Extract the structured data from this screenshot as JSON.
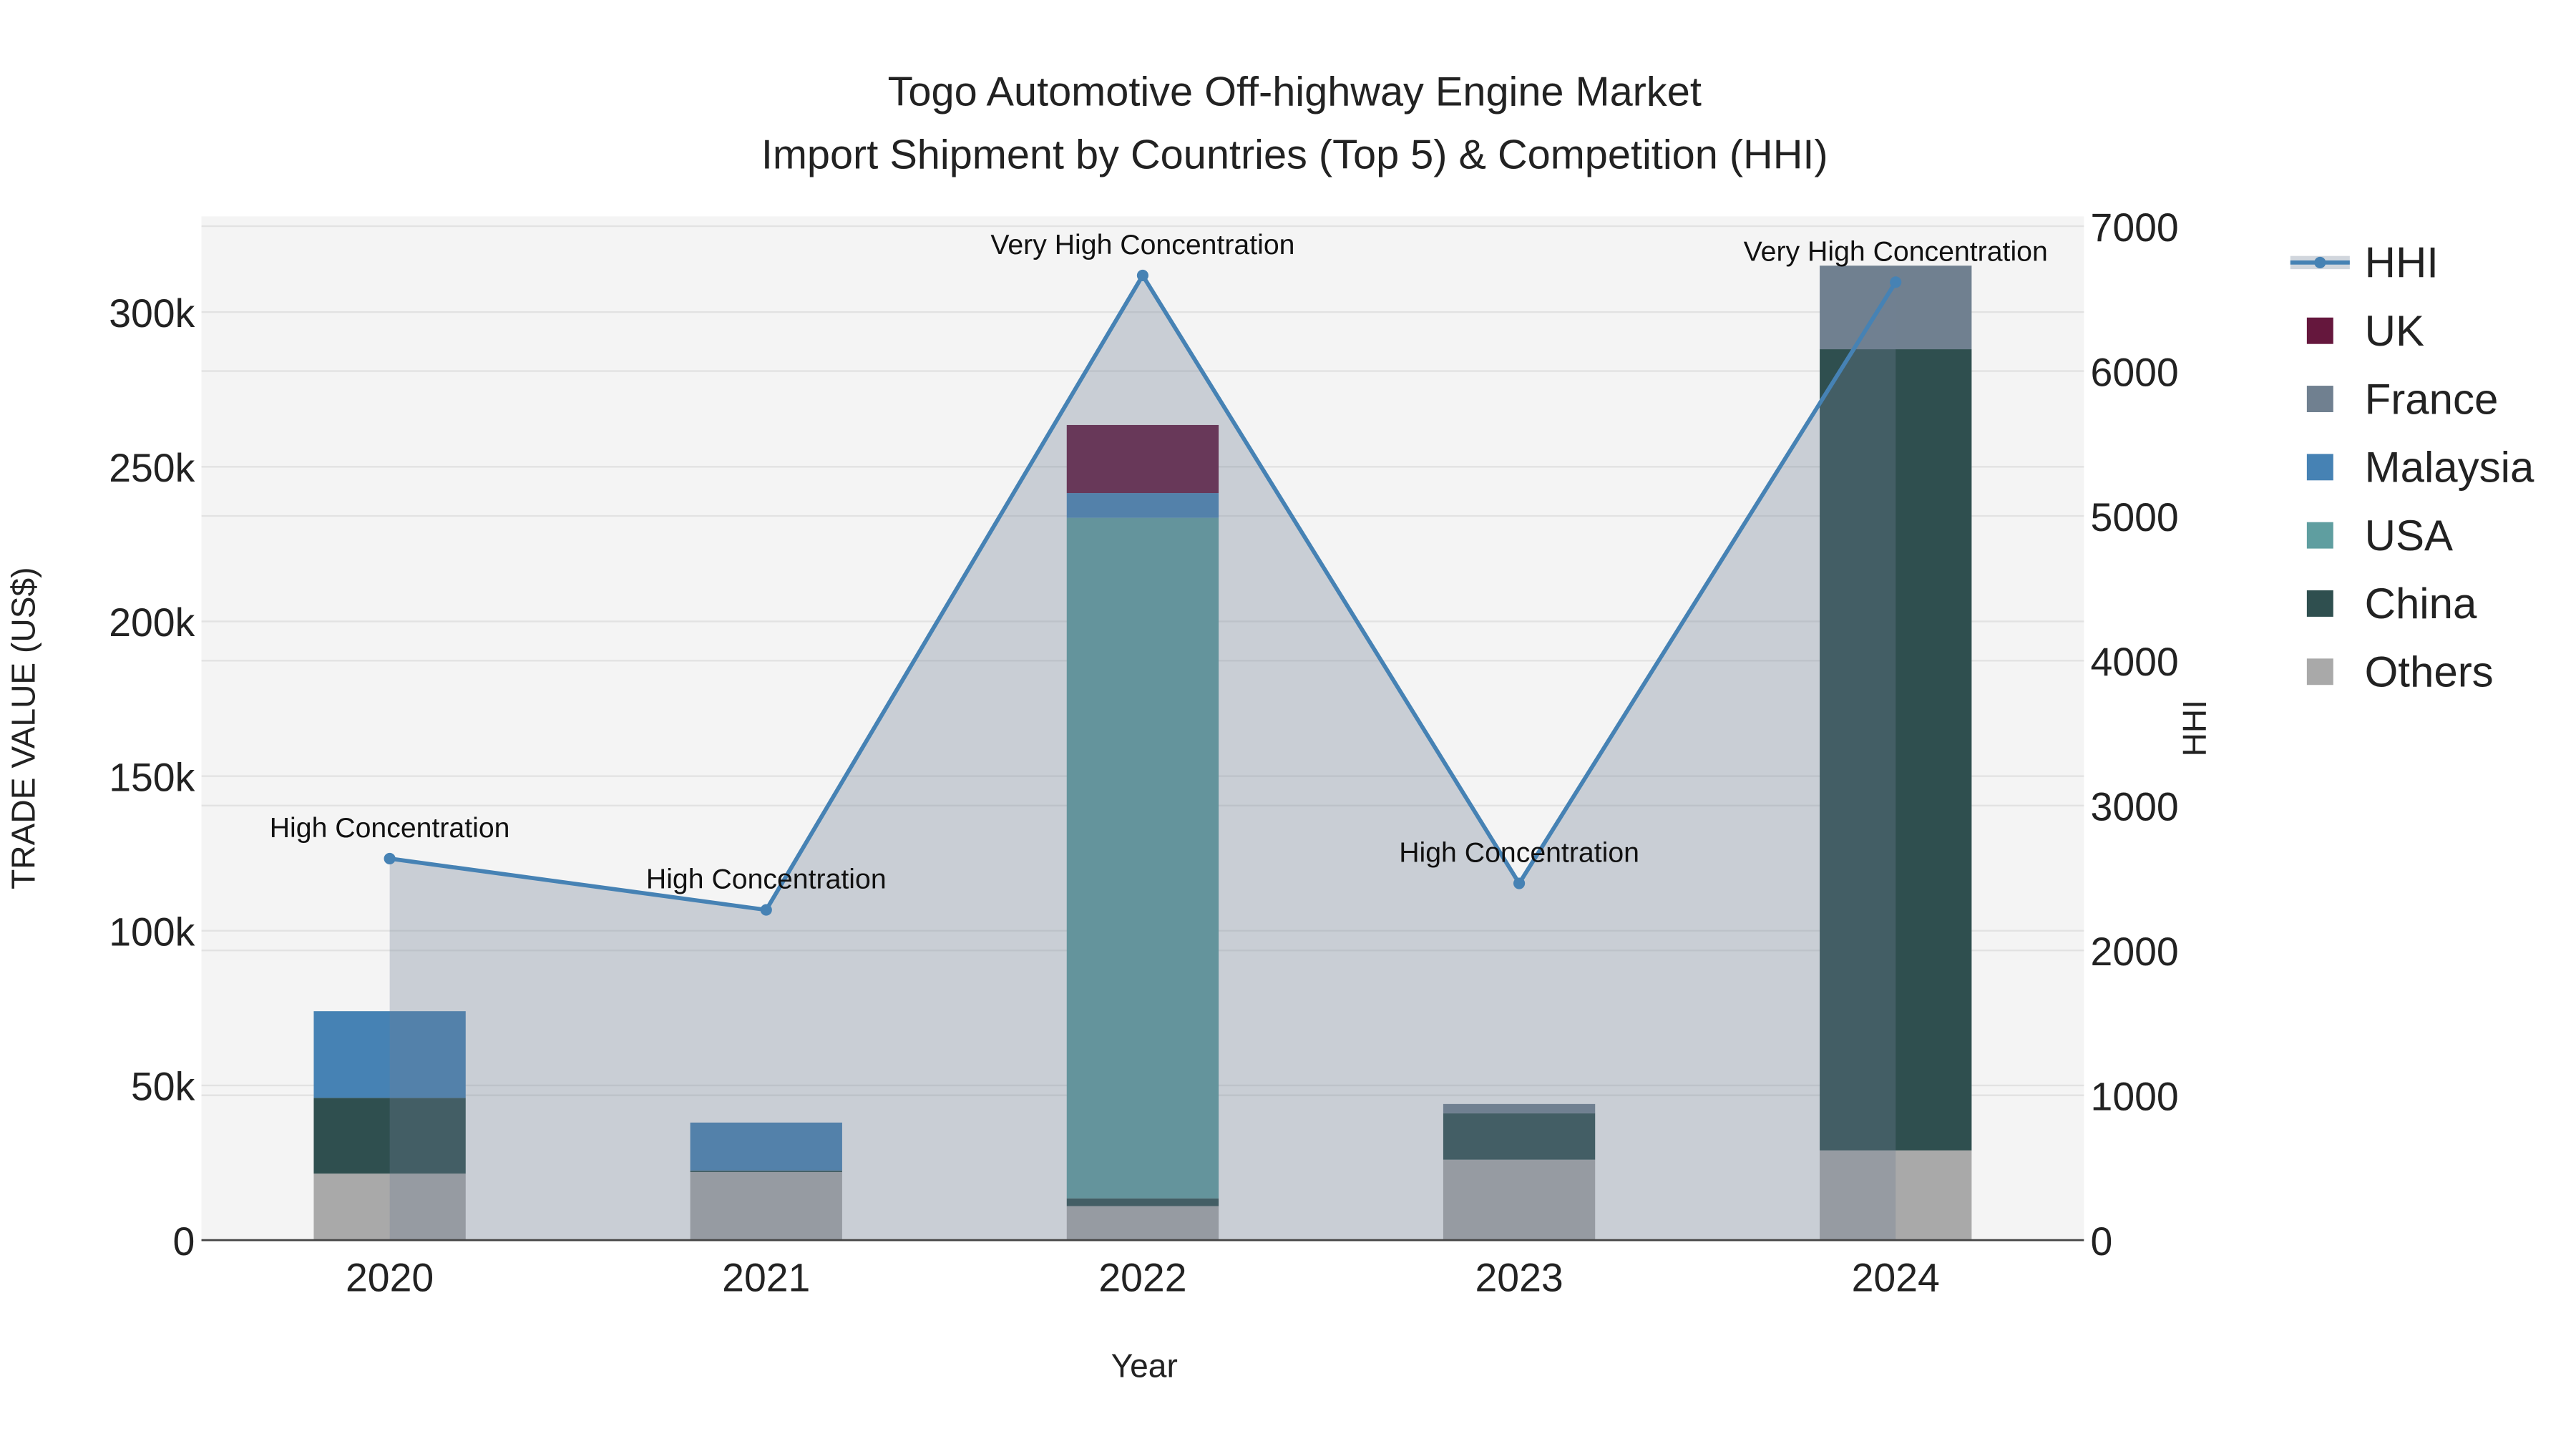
{
  "chart_data": {
    "type": "bar",
    "title": "Togo Automotive Off-highway Engine Market",
    "subtitle": "Import Shipment by Countries (Top 5) & Competition (HHI)",
    "xlabel": "Year",
    "ylabel": "TRADE VALUE (US$)",
    "y2label": "HHI",
    "categories": [
      "2020",
      "2021",
      "2022",
      "2023",
      "2024"
    ],
    "ylim": [
      0,
      330000
    ],
    "y2lim": [
      0,
      7070
    ],
    "yticks": [
      0,
      50000,
      100000,
      150000,
      200000,
      250000,
      300000
    ],
    "ytick_labels": [
      "0",
      "50k",
      "100k",
      "150k",
      "200k",
      "250k",
      "300k"
    ],
    "y2ticks": [
      0,
      1000,
      2000,
      3000,
      4000,
      5000,
      6000,
      7000
    ],
    "y2tick_labels": [
      "0",
      "1000",
      "2000",
      "3000",
      "4000",
      "5000",
      "6000",
      "7000"
    ],
    "series": [
      {
        "name": "Others",
        "color": "#a9a9a9",
        "values": [
          21500,
          22000,
          11000,
          26000,
          29000
        ]
      },
      {
        "name": "China",
        "color": "#2f4f4f",
        "values": [
          24500,
          500,
          2500,
          15000,
          259000
        ]
      },
      {
        "name": "USA",
        "color": "#5f9ea0",
        "values": [
          0,
          0,
          220000,
          0,
          0
        ]
      },
      {
        "name": "Malaysia",
        "color": "#4682b4",
        "values": [
          28000,
          15500,
          8000,
          0,
          0
        ]
      },
      {
        "name": "France",
        "color": "#708090",
        "values": [
          0,
          0,
          0,
          3000,
          27000
        ]
      },
      {
        "name": "UK",
        "color": "#65173d",
        "values": [
          0,
          0,
          22000,
          0,
          0
        ]
      }
    ],
    "hhi": {
      "name": "HHI",
      "color": "#4682b4",
      "values": [
        2634,
        2280,
        6660,
        2463,
        6614
      ]
    },
    "annotations": [
      "High Concentration",
      "High Concentration",
      "Very High Concentration",
      "High Concentration",
      "Very High Concentration"
    ],
    "legend": [
      "HHI",
      "UK",
      "France",
      "Malaysia",
      "USA",
      "China",
      "Others"
    ],
    "legend_position": "right",
    "grid": true
  }
}
